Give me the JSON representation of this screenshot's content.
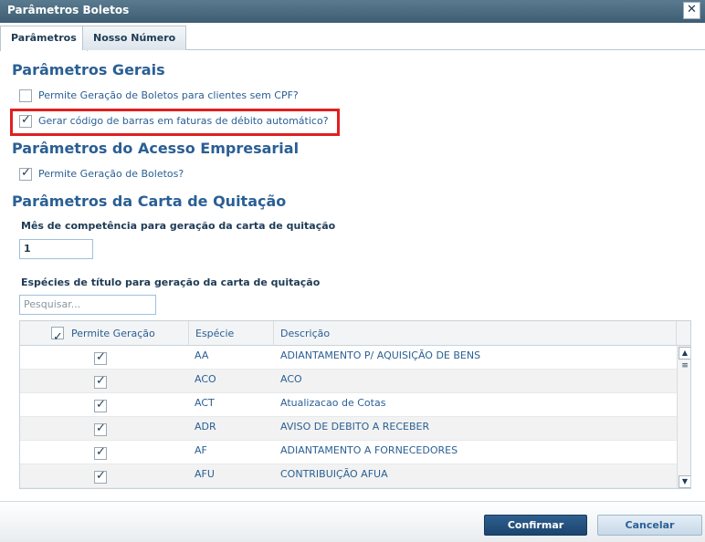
{
  "window": {
    "title": "Parâmetros Boletos",
    "close_glyph": "✕"
  },
  "tabs": [
    {
      "label": "Parâmetros",
      "active": true
    },
    {
      "label": "Nosso Número",
      "active": false
    }
  ],
  "sections": {
    "gerais": {
      "title": "Parâmetros Gerais",
      "options": [
        {
          "label": "Permite Geração de Boletos para clientes sem CPF?",
          "checked": false
        },
        {
          "label": "Gerar código de barras em faturas de débito automático?",
          "checked": true
        }
      ]
    },
    "acesso": {
      "title": "Parâmetros do Acesso Empresarial",
      "options": [
        {
          "label": "Permite Geração de Boletos?",
          "checked": true
        }
      ]
    },
    "carta": {
      "title": "Parâmetros da Carta de Quitação",
      "mes_label": "Mês de competência para geração da carta de quitação",
      "mes_value": "1",
      "especies_label": "Espécies de título para geração da carta de quitação",
      "search_placeholder": "Pesquisar..."
    }
  },
  "grid": {
    "columns": [
      "Permite Geração",
      "Espécie",
      "Descrição"
    ],
    "header_checked": true,
    "rows": [
      {
        "checked": true,
        "especie": "AA",
        "descricao": "ADIANTAMENTO P/ AQUISIÇÃO DE BENS"
      },
      {
        "checked": true,
        "especie": "ACO",
        "descricao": "ACO"
      },
      {
        "checked": true,
        "especie": "ACT",
        "descricao": "Atualizacao de Cotas"
      },
      {
        "checked": true,
        "especie": "ADR",
        "descricao": "AVISO DE DEBITO A RECEBER"
      },
      {
        "checked": true,
        "especie": "AF",
        "descricao": "ADIANTAMENTO A FORNECEDORES"
      },
      {
        "checked": true,
        "especie": "AFU",
        "descricao": "CONTRIBUIÇÃO AFUA"
      }
    ]
  },
  "footer": {
    "confirm_label": "Confirmar",
    "cancel_label": "Cancelar"
  },
  "colors": {
    "accent": "#2a5f94",
    "highlight": "#e02020",
    "titlebar": "#4a6a80"
  }
}
